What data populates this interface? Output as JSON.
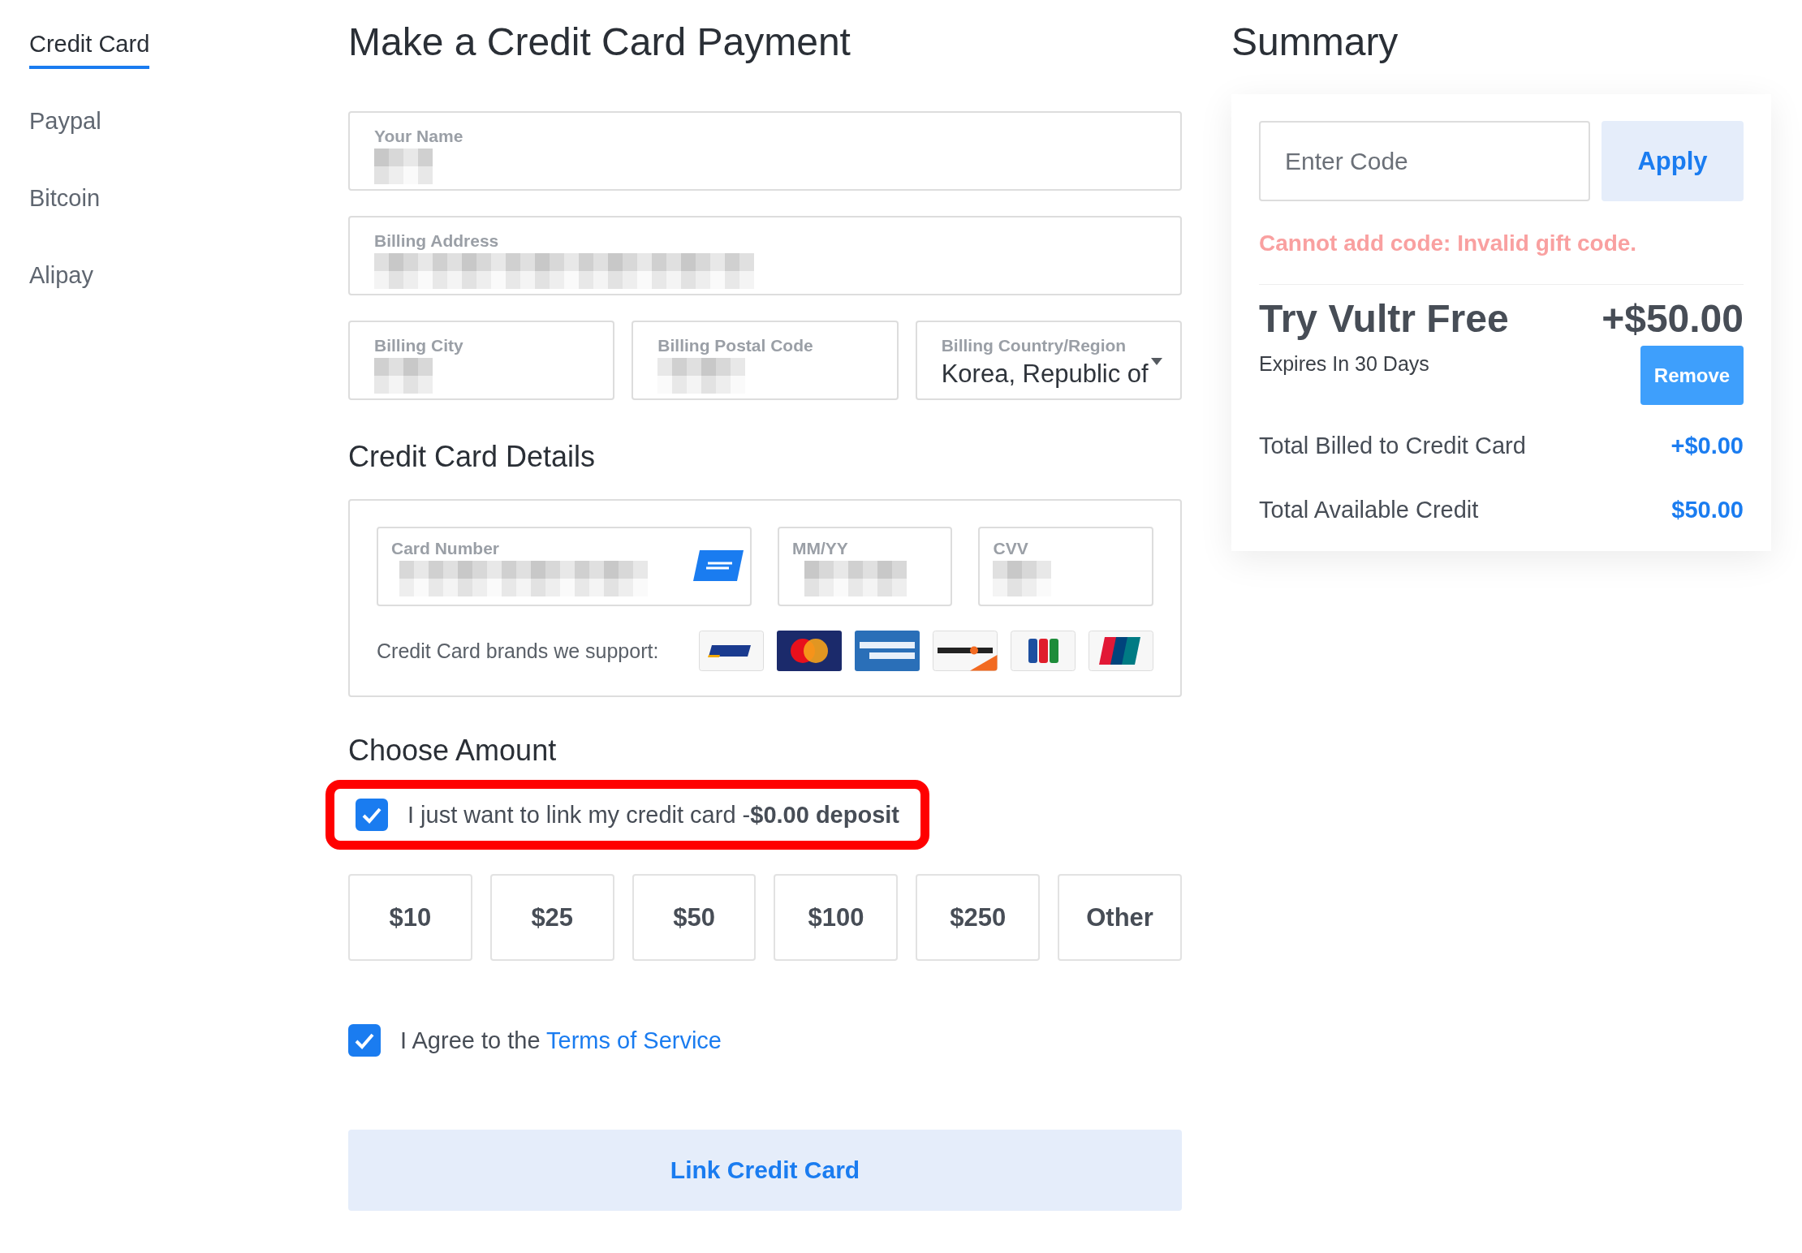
{
  "sidebar": {
    "items": [
      {
        "label": "Credit Card",
        "selected": true
      },
      {
        "label": "Paypal",
        "selected": false
      },
      {
        "label": "Bitcoin",
        "selected": false
      },
      {
        "label": "Alipay",
        "selected": false
      }
    ]
  },
  "form": {
    "title": "Make a Credit Card Payment",
    "fields": [
      {
        "label": "Your Name",
        "kind": "redacted"
      },
      {
        "label": "Billing Address",
        "kind": "redacted"
      },
      {
        "label": "Billing City",
        "kind": "redacted"
      },
      {
        "label": "Billing Postal Code",
        "kind": "redacted"
      },
      {
        "label": "Billing Country/Region",
        "kind": "select",
        "value": "Korea, Republic of"
      }
    ],
    "card_title": "Credit Card Details",
    "card_fields": [
      {
        "label": "Card Number",
        "kind": "redacted"
      },
      {
        "label": "MM/YY",
        "kind": "redacted"
      },
      {
        "label": "CVV",
        "kind": "redacted"
      }
    ],
    "brands_label": "Credit Card brands we support:",
    "amount_title": "Choose Amount",
    "link_option": {
      "text": "I just want to link my credit card -**$0.00 deposit**",
      "checked": true,
      "highlighted": true
    },
    "amounts": [
      {
        "label": "$10",
        "selected": false
      },
      {
        "label": "$25",
        "selected": false
      },
      {
        "label": "$50",
        "selected": false
      },
      {
        "label": "$100",
        "selected": false
      },
      {
        "label": "$250",
        "selected": false
      },
      {
        "label": "Other",
        "selected": false
      }
    ],
    "agree": {
      "text": "I Agree to the",
      "link": "Terms of Service",
      "checked": true
    },
    "submit": "Link Credit Card"
  },
  "summary": {
    "title": "Summary",
    "code": {
      "placeholder": "Enter Code"
    },
    "apply": "Apply",
    "error": "Cannot add code: Invalid gift code.",
    "promo": {
      "name": "Try Vultr Free",
      "amount": "+$50.00",
      "note": "Expires In 30 Days",
      "remove": "Remove"
    },
    "totals": [
      {
        "label": "Total Billed to Credit Card",
        "value": "+$0.00"
      },
      {
        "label": "Total Available Credit",
        "value": "$50.00"
      }
    ]
  }
}
